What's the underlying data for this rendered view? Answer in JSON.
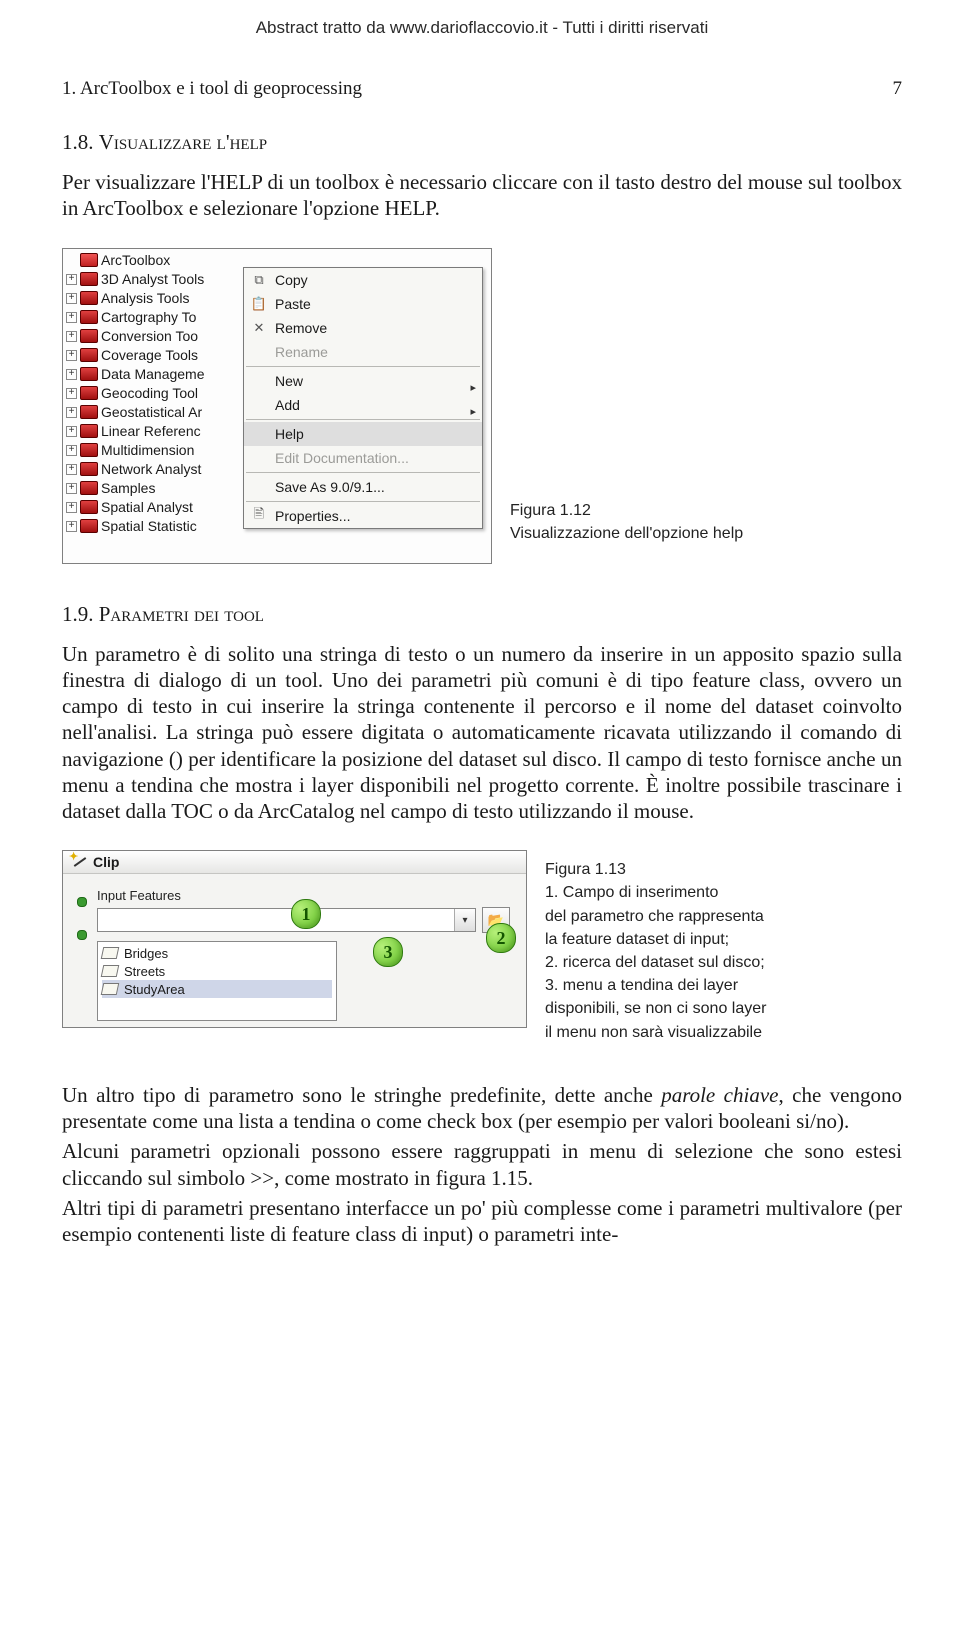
{
  "header": "Abstract tratto da www.darioflaccovio.it - Tutti i diritti riservati",
  "chapter": {
    "title": "1. ArcToolbox e i tool di geoprocessing",
    "page": "7"
  },
  "s18": {
    "heading_num": "1.8. ",
    "heading_main": "Visualizzare l'help",
    "para": "Per visualizzare l'HELP di un toolbox è necessario cliccare con il tasto destro del mouse sul toolbox in ArcToolbox e selezionare l'opzione HELP."
  },
  "panel": {
    "root": "ArcToolbox",
    "items": [
      "3D Analyst Tools",
      "Analysis Tools",
      "Cartography To",
      "Conversion Too",
      "Coverage Tools",
      "Data Manageme",
      "Geocoding Tool",
      "Geostatistical Ar",
      "Linear Referenc",
      "Multidimension",
      "Network Analyst",
      "Samples",
      "Spatial Analyst",
      "Spatial Statistic"
    ],
    "menu": {
      "copy": "Copy",
      "paste": "Paste",
      "remove": "Remove",
      "rename": "Rename",
      "new": "New",
      "add": "Add",
      "help": "Help",
      "edit": "Edit Documentation...",
      "save": "Save As 9.0/9.1...",
      "props": "Properties..."
    }
  },
  "fig12": {
    "num": "Figura 1.12",
    "cap": "Visualizzazione dell'opzione help"
  },
  "s19": {
    "heading_num": "1.9. ",
    "heading_main": "Parametri dei tool",
    "para": "Un parametro è di solito una stringa di testo o un numero da inserire in un apposito spazio sulla finestra di dialogo di un tool. Uno dei parametri più comuni è di tipo feature class, ovvero un campo di testo in cui inserire la stringa contenente il percorso e il nome del dataset coinvolto nell'analisi. La stringa può essere digitata o automaticamente ricavata utilizzando il comando di navigazione () per identificare la posizione del dataset sul disco. Il campo di testo fornisce anche un menu a tendina che mostra i layer disponibili nel progetto corrente. È inoltre possibile trascinare i dataset dalla TOC o da ArcCatalog nel campo di testo utilizzando il mouse."
  },
  "clip": {
    "title": "Clip",
    "label": "Input Features",
    "items": [
      "Bridges",
      "Streets",
      "StudyArea"
    ],
    "n1": "1",
    "n2": "2",
    "n3": "3"
  },
  "fig13": {
    "num": "Figura 1.13",
    "l1": "1. Campo di inserimento",
    "l2": "del parametro che rappresenta",
    "l3": "la feature dataset di input;",
    "l4": "2. ricerca del dataset sul disco;",
    "l5": "3. menu a tendina dei layer",
    "l6": "disponibili, se non ci sono layer",
    "l7": "il menu non sarà visualizzabile"
  },
  "final": {
    "p1a": "Un altro tipo di parametro sono le stringhe predefinite, dette anche ",
    "p1i": "parole chiave",
    "p1b": ", che vengono presentate come una lista a tendina o come check box (per esempio per valori booleani si/no).",
    "p2": "Alcuni parametri opzionali possono essere raggruppati in menu di selezione che sono estesi cliccando sul simbolo >>, come mostrato in figura 1.15.",
    "p3": "Altri tipi di parametri presentano interfacce un po' più complesse come i parametri multivalore (per esempio contenenti liste di feature class di input) o parametri inte-"
  }
}
